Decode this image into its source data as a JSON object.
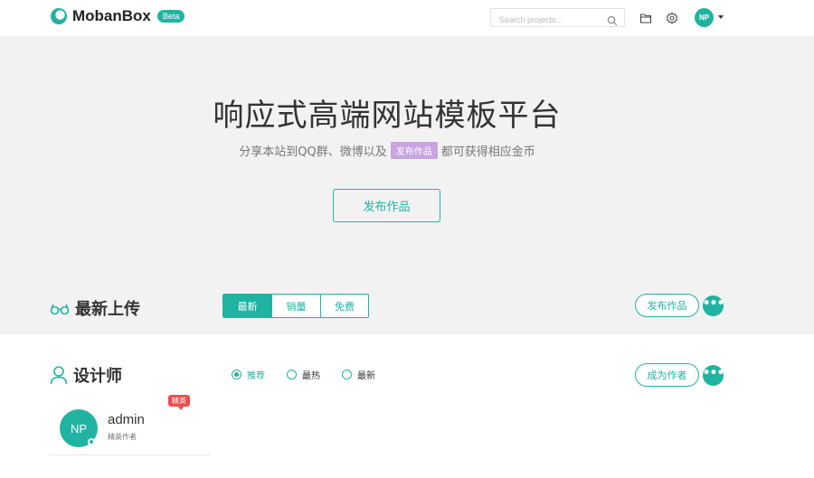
{
  "brand": {
    "name": "MobanBox",
    "badge": "Beta",
    "accent_color": "#21b3a1"
  },
  "navbar": {
    "search_placeholder": "Search projects...",
    "icons": [
      "search-icon",
      "folder-icon",
      "gear-icon",
      "caret-down-icon"
    ],
    "user_initials": "NP"
  },
  "hero": {
    "title": "响应式高端网站模板平台",
    "subtitle_before": "分享本站到QQ群、微博以及",
    "subtitle_tag": "发布作品",
    "subtitle_after": "都可获得相应金币",
    "button_label": "发布作品"
  },
  "latest": {
    "title": "最新上传",
    "tabs": [
      {
        "label": "最新",
        "active": true
      },
      {
        "label": "销量",
        "active": false
      },
      {
        "label": "免费",
        "active": false
      }
    ],
    "publish_label": "发布作品",
    "more_label": "•••"
  },
  "designers": {
    "title": "设计师",
    "filters": [
      {
        "label": "推荐",
        "checked": true
      },
      {
        "label": "最热",
        "checked": false
      },
      {
        "label": "最新",
        "checked": false
      }
    ],
    "become_author_label": "成为作者",
    "more_label": "•••",
    "cards": [
      {
        "initials": "NP",
        "name": "admin",
        "role": "精英作者",
        "badge": "精英"
      }
    ]
  }
}
